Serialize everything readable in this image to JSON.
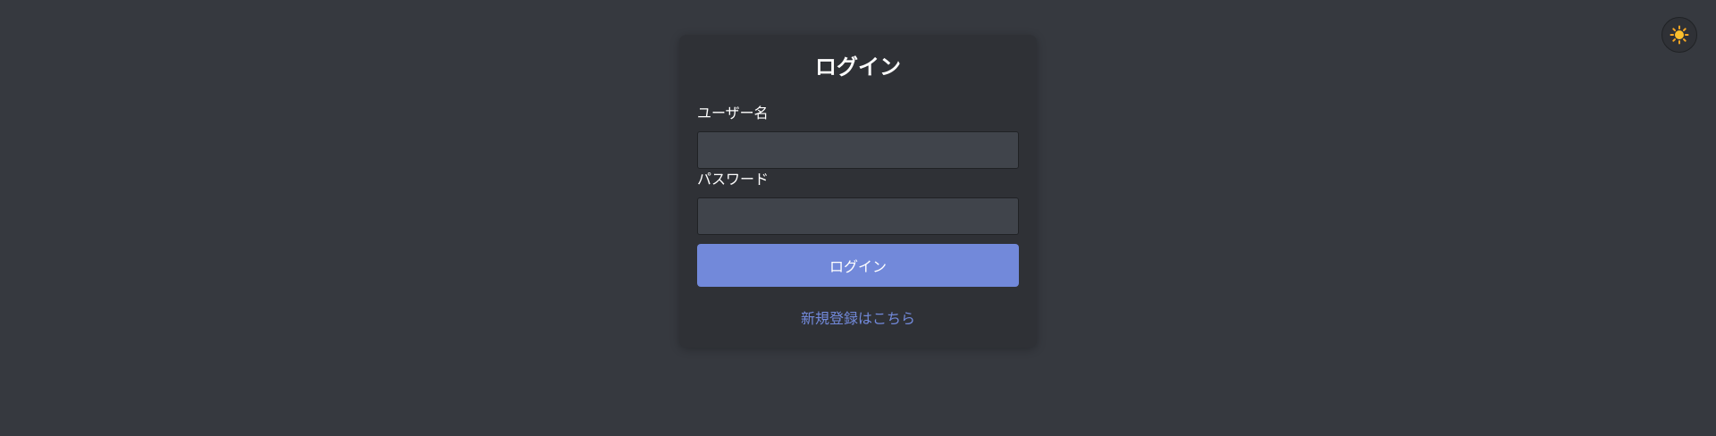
{
  "theme_toggle": {
    "icon": "sun-icon",
    "glyph": "☀️"
  },
  "login_form": {
    "title": "ログイン",
    "username_label": "ユーザー名",
    "username_value": "",
    "password_label": "パスワード",
    "password_value": "",
    "submit_label": "ログイン",
    "register_link": "新規登録はこちら"
  },
  "colors": {
    "background": "#36393f",
    "card": "#2f3136",
    "input": "#40444b",
    "accent": "#7289da",
    "text": "#ffffff"
  }
}
